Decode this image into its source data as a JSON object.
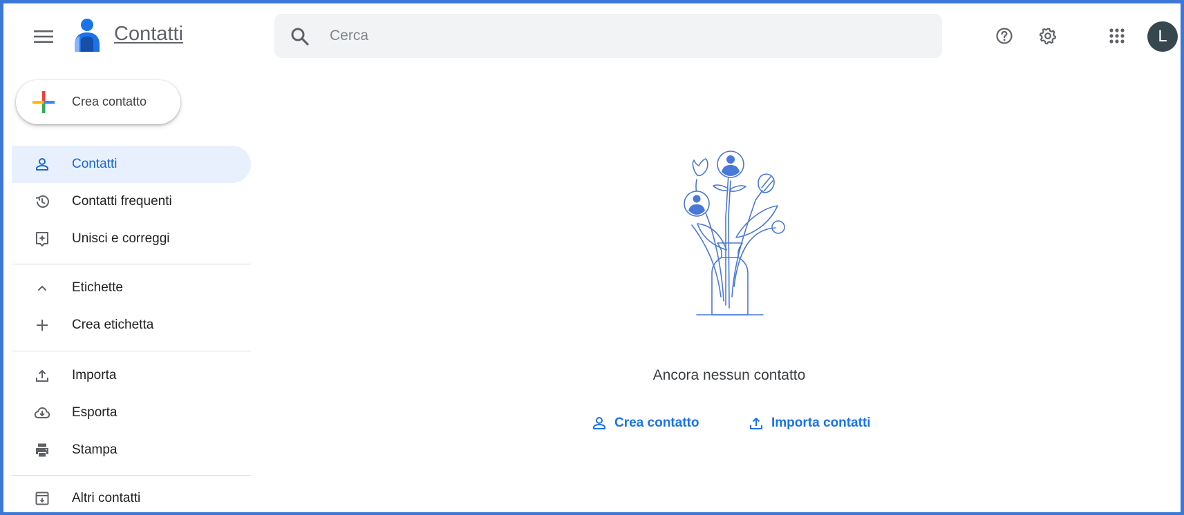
{
  "app": {
    "title": "Contatti",
    "avatar_letter": "L",
    "avatar_color": "#37474f"
  },
  "search": {
    "placeholder": "Cerca",
    "value": ""
  },
  "header_icons": [
    "menu-icon",
    "help-icon",
    "settings-icon",
    "apps-grid-icon"
  ],
  "sidebar": {
    "create_label": "Crea contatto",
    "items": [
      {
        "label": "Contatti",
        "icon": "person-icon",
        "active": true
      },
      {
        "label": "Contatti frequenti",
        "icon": "history-icon"
      },
      {
        "label": "Unisci e correggi",
        "icon": "merge-icon"
      },
      {
        "label": "Etichette",
        "icon": "chevron-up-icon"
      },
      {
        "label": "Crea etichetta",
        "icon": "plus-icon"
      },
      {
        "label": "Importa",
        "icon": "upload-icon"
      },
      {
        "label": "Esporta",
        "icon": "cloud-download-icon"
      },
      {
        "label": "Stampa",
        "icon": "printer-icon"
      },
      {
        "label": "Altri contatti",
        "icon": "archive-icon"
      }
    ]
  },
  "main": {
    "empty_text": "Ancora nessun contatto",
    "create_link": "Crea contatto",
    "import_link": "Importa contatti"
  },
  "colors": {
    "accent": "#1a73e8",
    "active_bg": "#e8f0fe",
    "frame": "#3c78d8"
  }
}
